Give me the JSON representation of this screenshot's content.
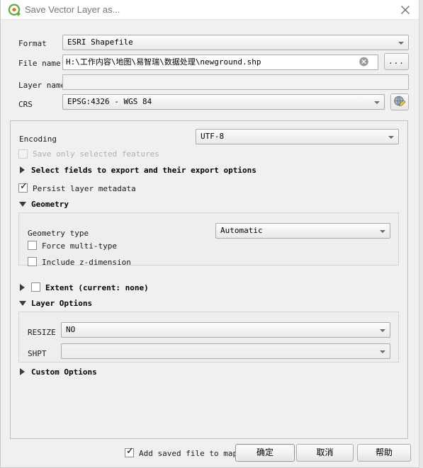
{
  "window": {
    "title": "Save Vector Layer as...",
    "logo_icon": "qgis-logo-icon",
    "close_icon": "close-icon"
  },
  "form": {
    "format": {
      "label": "Format",
      "value": "ESRI Shapefile"
    },
    "file_name": {
      "label": "File name",
      "value": "H:\\工作内容\\地图\\易智瑞\\数据处理\\newground.shp",
      "clear_icon": "clear-circle-icon",
      "browse_label": "..."
    },
    "layer_name": {
      "label": "Layer name",
      "value": "",
      "placeholder": ""
    },
    "crs": {
      "label": "CRS",
      "value": "EPSG:4326 - WGS 84",
      "select_icon": "globe-edit-icon"
    }
  },
  "options": {
    "encoding": {
      "label": "Encoding",
      "value": "UTF-8"
    },
    "save_only_selected": {
      "label": "Save only selected features",
      "checked": false,
      "enabled": false
    },
    "select_fields": {
      "label": "Select fields to export and their export options",
      "expanded": false
    },
    "persist_metadata": {
      "label": "Persist layer metadata",
      "checked": true
    },
    "geometry": {
      "title": "Geometry",
      "expanded": true,
      "geometry_type": {
        "label": "Geometry type",
        "value": "Automatic"
      },
      "force_multi": {
        "label": "Force multi-type",
        "checked": false
      },
      "include_z": {
        "label": "Include z-dimension",
        "checked": false
      }
    },
    "extent": {
      "label": "Extent (current: none)",
      "checked": false,
      "expanded": false
    },
    "layer_options": {
      "title": "Layer Options",
      "expanded": true,
      "rows": [
        {
          "label": "RESIZE",
          "value": "NO",
          "enabled": true
        },
        {
          "label": "SHPT",
          "value": "",
          "enabled": false
        }
      ]
    },
    "custom_options": {
      "title": "Custom Options",
      "expanded": false
    }
  },
  "footer": {
    "add_to_map": {
      "label": "Add saved file to map",
      "checked": true
    },
    "ok_label": "确定",
    "cancel_label": "取消",
    "help_label": "帮助"
  }
}
